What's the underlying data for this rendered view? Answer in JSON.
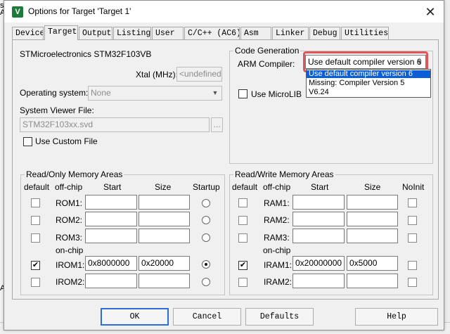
{
  "window": {
    "title": "Options for Target 'Target 1'",
    "icon": "keil-uvision-icon",
    "close_glyph": "✕"
  },
  "tabs": [
    "Device",
    "Target",
    "Output",
    "Listing",
    "User",
    "C/C++ (AC6)",
    "Asm",
    "Linker",
    "Debug",
    "Utilities"
  ],
  "active_tab": "Target",
  "target": {
    "device_name": "STMicroelectronics STM32F103VB",
    "xtal_label": "Xtal (MHz):",
    "xtal_value": "<undefined>",
    "os_label": "Operating system:",
    "os_value": "None",
    "svd_label": "System Viewer File:",
    "svd_value": "STM32F103xx.svd",
    "browse_label": "...",
    "use_custom_file_label": "Use Custom File",
    "use_custom_file_checked": false
  },
  "code_generation": {
    "group_title": "Code Generation",
    "compiler_label": "ARM Compiler:",
    "compiler_value": "Use default compiler version 6",
    "options": [
      "Use default compiler version 6",
      "Missing: Compiler Version 5",
      "V6.24"
    ],
    "selected_option": "Use default compiler version 6",
    "microlib_label": "Use MicroLIB",
    "microlib_checked": false,
    "highlight_color": "#e05555"
  },
  "ro_memory": {
    "group_title": "Read/Only Memory Areas",
    "headers": {
      "default": "default",
      "offchip": "off-chip",
      "start": "Start",
      "size": "Size",
      "startup": "Startup"
    },
    "onchip_label": "on-chip",
    "rows": [
      {
        "name": "ROM1:",
        "start": "",
        "size": "",
        "default": false,
        "startup": false
      },
      {
        "name": "ROM2:",
        "start": "",
        "size": "",
        "default": false,
        "startup": false
      },
      {
        "name": "ROM3:",
        "start": "",
        "size": "",
        "default": false,
        "startup": false
      },
      {
        "name": "IROM1:",
        "start": "0x8000000",
        "size": "0x20000",
        "default": true,
        "startup": true
      },
      {
        "name": "IROM2:",
        "start": "",
        "size": "",
        "default": false,
        "startup": false
      }
    ]
  },
  "rw_memory": {
    "group_title": "Read/Write Memory Areas",
    "headers": {
      "default": "default",
      "offchip": "off-chip",
      "start": "Start",
      "size": "Size",
      "noinit": "NoInit"
    },
    "onchip_label": "on-chip",
    "rows": [
      {
        "name": "RAM1:",
        "start": "",
        "size": "",
        "default": false,
        "noinit": false
      },
      {
        "name": "RAM2:",
        "start": "",
        "size": "",
        "default": false,
        "noinit": false
      },
      {
        "name": "RAM3:",
        "start": "",
        "size": "",
        "default": false,
        "noinit": false
      },
      {
        "name": "IRAM1:",
        "start": "0x20000000",
        "size": "0x5000",
        "default": true,
        "noinit": false
      },
      {
        "name": "IRAM2:",
        "start": "",
        "size": "",
        "default": false,
        "noinit": false
      }
    ]
  },
  "buttons": {
    "ok": "OK",
    "cancel": "Cancel",
    "defaults": "Defaults",
    "help": "Help"
  },
  "background_editor": {
    "left_chars": [
      "s",
      "A"
    ],
    "bottom_char": "A"
  }
}
